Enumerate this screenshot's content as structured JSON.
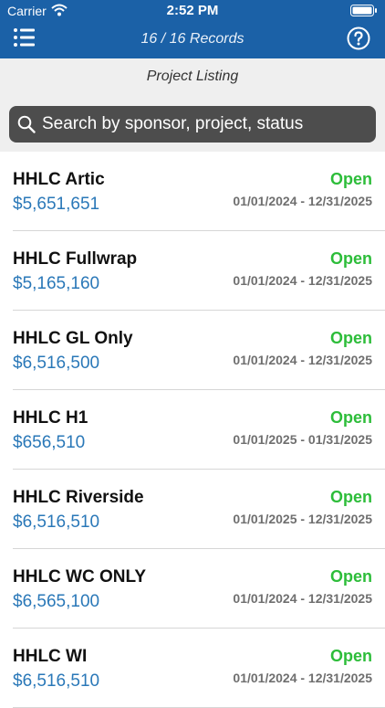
{
  "status_bar": {
    "carrier": "Carrier",
    "time": "2:52 PM"
  },
  "nav": {
    "title": "16 / 16 Records",
    "menu_icon": "hamburger-icon",
    "help_icon": "help-icon"
  },
  "subheader": {
    "title": "Project Listing"
  },
  "search": {
    "placeholder": "Search by sponsor, project, status",
    "value": ""
  },
  "colors": {
    "nav_bg": "#1b61a7",
    "amount": "#2a78b8",
    "status_open": "#2dbd3a",
    "dates": "#6f6f6f"
  },
  "projects": [
    {
      "name": "HHLC Artic",
      "amount": "$5,651,651",
      "status": "Open",
      "dates": "01/01/2024 - 12/31/2025"
    },
    {
      "name": "HHLC Fullwrap",
      "amount": "$5,165,160",
      "status": "Open",
      "dates": "01/01/2024 - 12/31/2025"
    },
    {
      "name": "HHLC GL Only",
      "amount": "$6,516,500",
      "status": "Open",
      "dates": "01/01/2024 - 12/31/2025"
    },
    {
      "name": "HHLC H1",
      "amount": "$656,510",
      "status": "Open",
      "dates": "01/01/2025 - 01/31/2025"
    },
    {
      "name": "HHLC Riverside",
      "amount": "$6,516,510",
      "status": "Open",
      "dates": "01/01/2025 - 12/31/2025"
    },
    {
      "name": "HHLC WC ONLY",
      "amount": "$6,565,100",
      "status": "Open",
      "dates": "01/01/2024 - 12/31/2025"
    },
    {
      "name": "HHLC WI",
      "amount": "$6,516,510",
      "status": "Open",
      "dates": "01/01/2024 - 12/31/2025"
    }
  ]
}
